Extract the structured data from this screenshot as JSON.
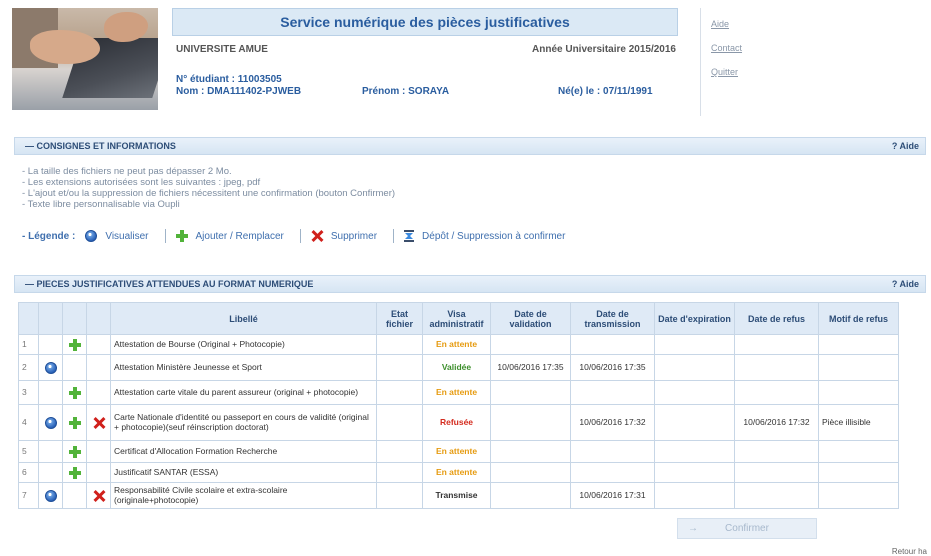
{
  "header": {
    "service_title": "Service numérique des pièces justificatives",
    "university": "UNIVERSITE AMUE",
    "academic_year": "Année Universitaire 2015/2016",
    "student_number": "N° étudiant : 11003505",
    "name": "Nom : DMA111402-PJWEB",
    "first_name": "Prénom : SORAYA",
    "birth_date": "Né(e) le : 07/11/1991"
  },
  "side_links": {
    "aide": "Aide",
    "contact": "Contact",
    "quitter": "Quitter"
  },
  "consignes": {
    "title": "— CONSIGNES ET INFORMATIONS",
    "help": "? Aide",
    "lines": [
      "- La taille des fichiers ne peut pas dépasser 2 Mo.",
      "- Les extensions autorisées sont les suivantes : jpeg, pdf",
      "- L'ajout et/ou la suppression de fichiers nécessitent une confirmation (bouton Confirmer)",
      "- Texte libre personnalisable via Oupli"
    ],
    "legend_label": "- Légende :",
    "legend_view": "Visualiser",
    "legend_add": "Ajouter / Remplacer",
    "legend_delete": "Supprimer",
    "legend_pending": "Dépôt / Suppression à confirmer"
  },
  "pieces": {
    "title": "— PIECES JUSTIFICATIVES ATTENDUES AU FORMAT NUMERIQUE",
    "help": "? Aide",
    "columns": {
      "libelle": "Libellé",
      "etat": "Etat fichier",
      "visa": "Visa administratif",
      "validation": "Date de validation",
      "transmission": "Date de transmission",
      "expiration": "Date d'expiration",
      "refus": "Date de refus",
      "motif": "Motif de refus"
    },
    "rows": [
      {
        "num": "1",
        "view": false,
        "add": true,
        "del": false,
        "libelle": "Attestation de Bourse (Original + Photocopie)",
        "visa": "En attente",
        "visa_status": "att",
        "validation": "",
        "transmission": "",
        "expiration": "",
        "refus": "",
        "motif": ""
      },
      {
        "num": "2",
        "view": true,
        "add": false,
        "del": false,
        "libelle": "Attestation Ministère Jeunesse et Sport",
        "visa": "Validée",
        "visa_status": "val",
        "validation": "10/06/2016 17:35",
        "transmission": "10/06/2016 17:35",
        "expiration": "",
        "refus": "",
        "motif": ""
      },
      {
        "num": "3",
        "view": false,
        "add": true,
        "del": false,
        "libelle": "Attestation carte vitale du parent assureur (original + photocopie)",
        "visa": "En attente",
        "visa_status": "att",
        "validation": "",
        "transmission": "",
        "expiration": "",
        "refus": "",
        "motif": ""
      },
      {
        "num": "4",
        "view": true,
        "add": true,
        "del": true,
        "libelle": "Carte Nationale d'identité ou passeport en cours de validité (original + photocopie)(seuf réinscription doctorat)",
        "visa": "Refusée",
        "visa_status": "ref",
        "validation": "",
        "transmission": "10/06/2016 17:32",
        "expiration": "",
        "refus": "10/06/2016 17:32",
        "motif": "Pièce illisible"
      },
      {
        "num": "5",
        "view": false,
        "add": true,
        "del": false,
        "libelle": "Certificat d'Allocation Formation Recherche",
        "visa": "En attente",
        "visa_status": "att",
        "validation": "",
        "transmission": "",
        "expiration": "",
        "refus": "",
        "motif": ""
      },
      {
        "num": "6",
        "view": false,
        "add": true,
        "del": false,
        "libelle": "Justificatif SANTAR (ESSA)",
        "visa": "En attente",
        "visa_status": "att",
        "validation": "",
        "transmission": "",
        "expiration": "",
        "refus": "",
        "motif": ""
      },
      {
        "num": "7",
        "view": true,
        "add": false,
        "del": true,
        "libelle": "Responsabilité Civile scolaire et extra-scolaire (originale+photocopie)",
        "visa": "Transmise",
        "visa_status": "tra",
        "validation": "",
        "transmission": "10/06/2016 17:31",
        "expiration": "",
        "refus": "",
        "motif": ""
      }
    ],
    "confirm_label": "Confirmer",
    "confirm_arrow": "→"
  },
  "footer": {
    "back_link": "Retour ha"
  }
}
